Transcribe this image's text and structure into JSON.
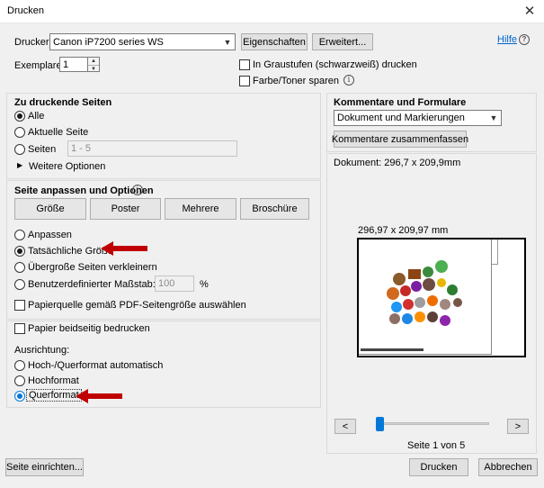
{
  "window": {
    "title": "Drucken",
    "close_glyph": "✕"
  },
  "printer": {
    "label": "Drucker:",
    "selected": "Canon iP7200 series WS",
    "properties_button": "Eigenschaften",
    "advanced_button": "Erweitert...",
    "help_link": "Hilfe"
  },
  "copies": {
    "label": "Exemplare:",
    "value": "1"
  },
  "options": {
    "grayscale_label": "In Graustufen (schwarzweiß) drucken",
    "save_ink_label": "Farbe/Toner sparen"
  },
  "pages": {
    "header": "Zu druckende Seiten",
    "all": "Alle",
    "current": "Aktuelle Seite",
    "pages": "Seiten",
    "pages_range": "1 - 5",
    "more_options": "Weitere Optionen"
  },
  "sizing": {
    "header": "Seite anpassen und Optionen",
    "buttons": [
      "Größe",
      "Poster",
      "Mehrere",
      "Broschüre"
    ],
    "fit": "Anpassen",
    "actual_size": "Tatsächliche Größe",
    "shrink": "Übergroße Seiten verkleinern",
    "custom_scale": "Benutzerdefinierter Maßstab:",
    "custom_scale_value": "100",
    "custom_scale_unit": "%",
    "paper_source": "Papierquelle gemäß PDF-Seitengröße auswählen"
  },
  "duplex": {
    "label": "Papier beidseitig bedrucken",
    "orientation_label": "Ausrichtung:",
    "auto": "Hoch-/Querformat automatisch",
    "portrait": "Hochformat",
    "landscape": "Querformat"
  },
  "comments": {
    "header": "Kommentare und Formulare",
    "selected": "Dokument und Markierungen",
    "summarize_button": "Kommentare zusammenfassen"
  },
  "preview": {
    "document_size": "Dokument: 296,7 x 209,9mm",
    "paper_size": "296,97 x 209,97 mm",
    "page_indicator": "Seite 1 von 5",
    "prev_glyph": "<",
    "next_glyph": ">",
    "slider_position": 0.0
  },
  "footer": {
    "page_setup_button": "Seite einrichten...",
    "print_button": "Drucken",
    "cancel_button": "Abbrechen"
  },
  "colors": {
    "accent": "#0078d7",
    "arrow": "#c00000"
  }
}
